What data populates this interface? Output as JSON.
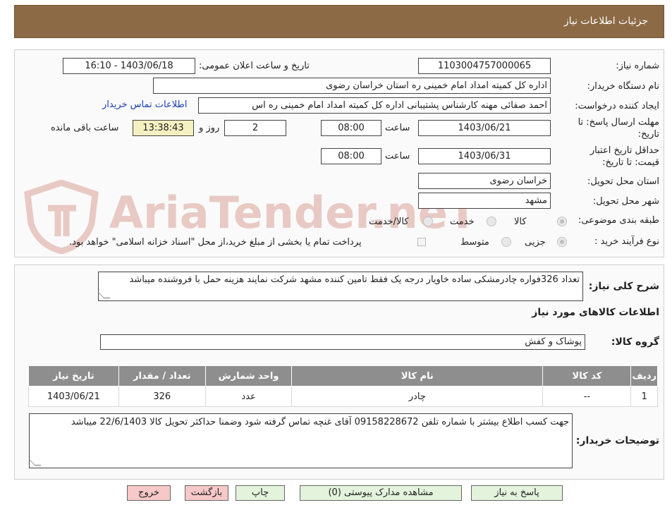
{
  "header": {
    "title": "جزئیات اطلاعات نیاز"
  },
  "form": {
    "need_number_label": "شماره نیاز:",
    "need_number": "1103004757000065",
    "announce_label": "تاریخ و ساعت اعلان عمومی:",
    "announce_value": "1403/06/18 - 16:10",
    "buyer_org_label": "نام دستگاه خریدار:",
    "buyer_org": "اداره کل کمیته امداد امام خمینی  ره  استان خراسان رضوی",
    "creator_label": "ایجاد کننده درخواست:",
    "creator": "احمد صفائی مهنه کارشناس پشتیبانی اداره کل کمیته امداد امام خمینی  ره  اس",
    "contact_link": "اطلاعات تماس خریدار",
    "deadline_label_1": "مهلت ارسال پاسخ: تا",
    "deadline_label_2": "تاریخ:",
    "deadline_date": "1403/06/21",
    "time_label": "ساعت",
    "deadline_time": "08:00",
    "days_value": "2",
    "days_label": "روز و",
    "remaining_time": "13:38:43",
    "remaining_label": "ساعت باقی مانده",
    "validity_label_1": "حداقل تاریخ اعتبار",
    "validity_label_2": "قیمت: تا تاریخ:",
    "validity_date": "1403/06/31",
    "validity_time": "08:00",
    "province_label": "استان محل تحویل:",
    "province": "خراسان رضوی",
    "city_label": "شهر محل تحویل:",
    "city": "مشهد",
    "category_label": "طبقه بندی موضوعی:",
    "category_options": [
      "کالا",
      "خدمت",
      "کالا/خدمت"
    ],
    "process_label": "نوع فرآیند خرید :",
    "process_options": [
      "جزیی",
      "متوسط"
    ],
    "payment_note": "پرداخت تمام یا بخشی از مبلغ خرید،از محل \"اسناد خزانه اسلامی\" خواهد بود."
  },
  "watermark": "AriaTender.neT",
  "description": {
    "label": "شرح کلی نیاز:",
    "text": "تعداد 326فواره چادرمشکی ساده خاویار درجه یک فقط تامین کننده مشهد شرکت نمایند هزینه حمل با فروشنده میباشد"
  },
  "goods": {
    "section_title": "اطلاعات کالاهای مورد نیاز",
    "group_label": "گروه کالا:",
    "group_value": "پوشاک و کفش",
    "columns": [
      "ردیف",
      "کد کالا",
      "نام کالا",
      "واحد شمارش",
      "تعداد / مقدار",
      "تاریخ نیاز"
    ],
    "rows": [
      [
        "1",
        "--",
        "چادر",
        "عدد",
        "326",
        "1403/06/21"
      ]
    ]
  },
  "buyer_notes": {
    "label": "توضیحات خریدار:",
    "text": "جهت کسب اطلاع بیشتر با شماره تلفن 09158228672 آقای غنچه تماس گرفته شود وضمنا حداکثر تحویل کالا 22/6/1403 میباشد"
  },
  "buttons": {
    "reply": "پاسخ به نیاز",
    "attachments": "مشاهده مدارک پیوستی (0)",
    "print": "چاپ",
    "back": "بازگشت",
    "exit": "خروج"
  },
  "colors": {
    "header_bg": "#8b6a45",
    "table_header_bg": "#8e8e8e",
    "remaining_bg": "#f5f0c0",
    "reply_btn_bg": "#e3f3dc",
    "exit_btn_bg": "#f6c8c8"
  }
}
